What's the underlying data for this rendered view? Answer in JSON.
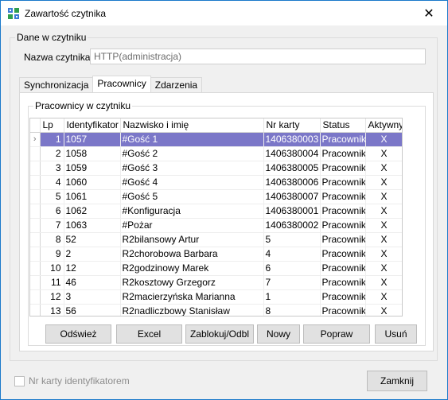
{
  "window": {
    "title": "Zawartość czytnika",
    "close_symbol": "✕"
  },
  "reader_group": {
    "legend": "Dane w czytniku",
    "name_label": "Nazwa czytnika",
    "name_value": "HTTP(administracja)"
  },
  "tabs": [
    {
      "label": "Synchronizacja",
      "active": false
    },
    {
      "label": "Pracownicy",
      "active": true
    },
    {
      "label": "Zdarzenia",
      "active": false
    }
  ],
  "employees_group": {
    "legend": "Pracownicy w czytniku"
  },
  "grid": {
    "columns": [
      "Lp",
      "Identyfikator",
      "Nazwisko i imię",
      "Nr karty",
      "Status",
      "Aktywny"
    ],
    "current_row_marker": "›",
    "selected_row": 0,
    "rows": [
      {
        "lp": "1",
        "id": "1057",
        "name": "#Gość 1",
        "card": "1406380003",
        "status": "Pracownik",
        "active": "X"
      },
      {
        "lp": "2",
        "id": "1058",
        "name": "#Gość 2",
        "card": "1406380004",
        "status": "Pracownik",
        "active": "X"
      },
      {
        "lp": "3",
        "id": "1059",
        "name": "#Gość 3",
        "card": "1406380005",
        "status": "Pracownik",
        "active": "X"
      },
      {
        "lp": "4",
        "id": "1060",
        "name": "#Gość 4",
        "card": "1406380006",
        "status": "Pracownik",
        "active": "X"
      },
      {
        "lp": "5",
        "id": "1061",
        "name": "#Gość 5",
        "card": "1406380007",
        "status": "Pracownik",
        "active": "X"
      },
      {
        "lp": "6",
        "id": "1062",
        "name": "#Konfiguracja",
        "card": "1406380001",
        "status": "Pracownik",
        "active": "X"
      },
      {
        "lp": "7",
        "id": "1063",
        "name": "#Pożar",
        "card": "1406380002",
        "status": "Pracownik",
        "active": "X"
      },
      {
        "lp": "8",
        "id": "52",
        "name": "R2bilansowy Artur",
        "card": "5",
        "status": "Pracownik",
        "active": "X"
      },
      {
        "lp": "9",
        "id": "2",
        "name": "R2chorobowa Barbara",
        "card": "4",
        "status": "Pracownik",
        "active": "X"
      },
      {
        "lp": "10",
        "id": "12",
        "name": "R2godzinowy Marek",
        "card": "6",
        "status": "Pracownik",
        "active": "X"
      },
      {
        "lp": "11",
        "id": "46",
        "name": "R2kosztowy Grzegorz",
        "card": "7",
        "status": "Pracownik",
        "active": "X"
      },
      {
        "lp": "12",
        "id": "3",
        "name": "R2macierzyńska Marianna",
        "card": "1",
        "status": "Pracownik",
        "active": "X"
      },
      {
        "lp": "13",
        "id": "56",
        "name": "R2nadliczbowy Stanisław",
        "card": "8",
        "status": "Pracownik",
        "active": "X"
      }
    ]
  },
  "buttons": {
    "refresh": "Odśwież",
    "excel": "Excel",
    "block": "Zablokuj/Odbl",
    "new": "Nowy",
    "edit": "Popraw",
    "delete": "Usuń",
    "close": "Zamknij"
  },
  "footer": {
    "card_as_id_label": "Nr karty identyfikatorem"
  },
  "colors": {
    "selection": "#7b77c8",
    "title_border": "#1979ca"
  }
}
